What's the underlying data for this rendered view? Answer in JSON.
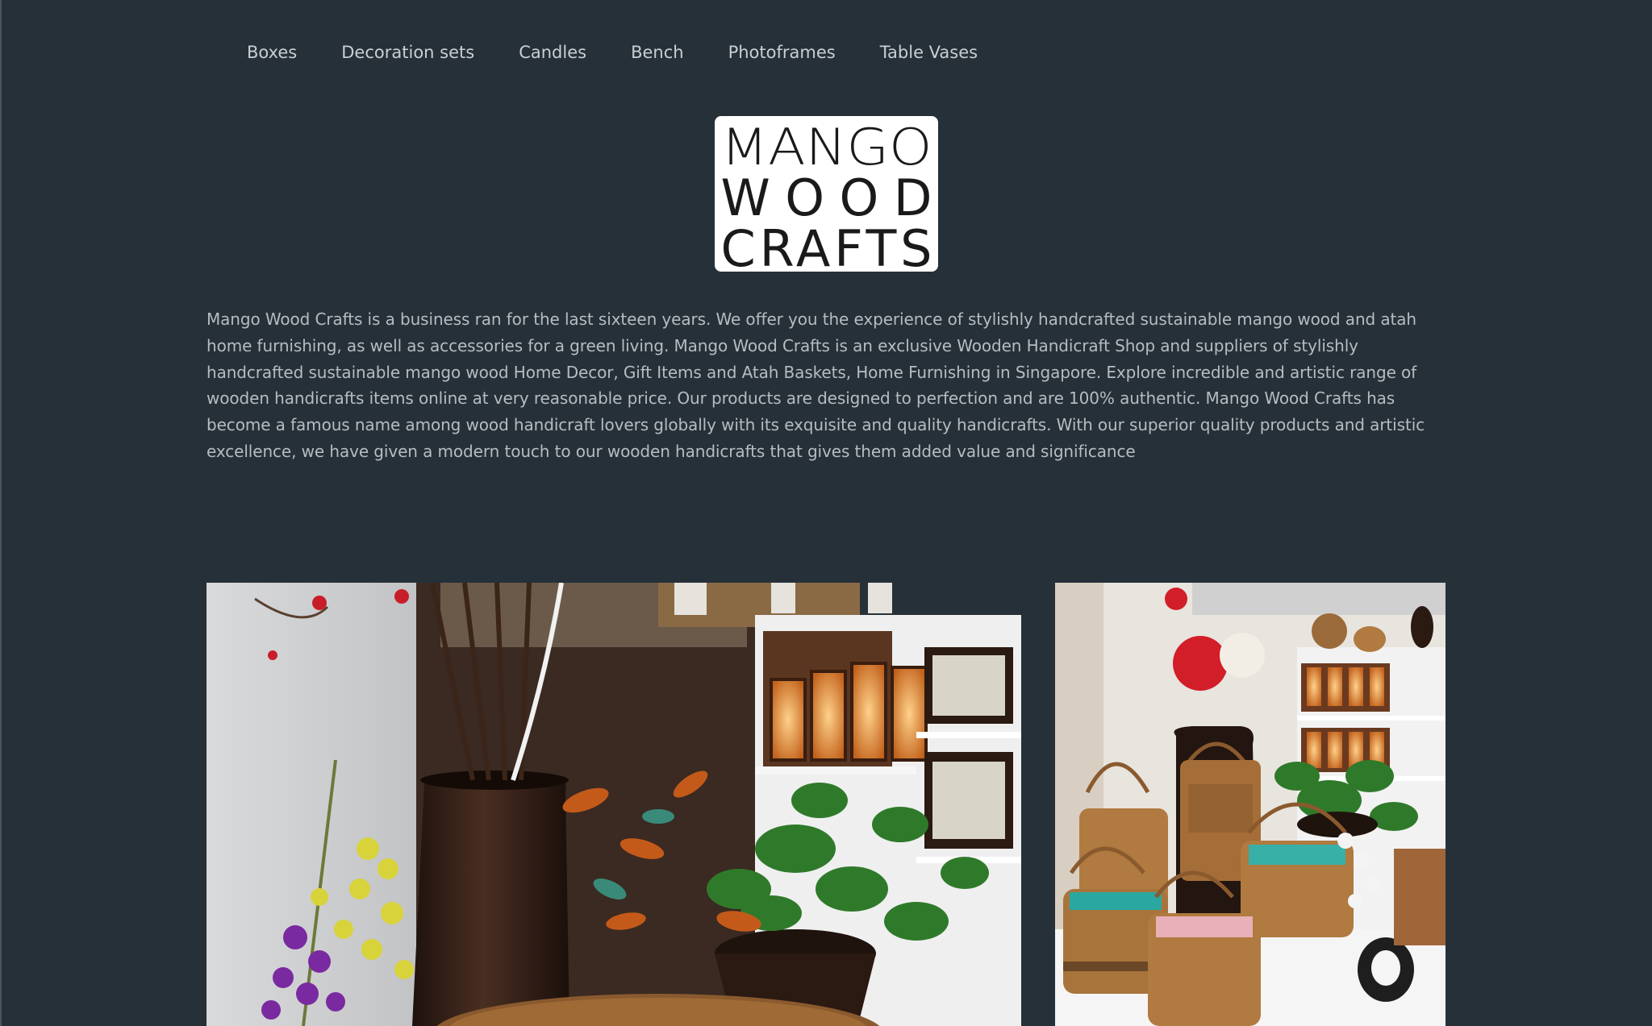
{
  "nav": {
    "items": [
      {
        "label": "Boxes"
      },
      {
        "label": "Decoration sets"
      },
      {
        "label": "Candles"
      },
      {
        "label": "Bench"
      },
      {
        "label": "Photoframes"
      },
      {
        "label": "Table Vases"
      }
    ]
  },
  "logo": {
    "line1": "MANGO",
    "line2": "WOOD",
    "line3": "CRAFTS"
  },
  "description": "Mango Wood Crafts is a business ran for the last sixteen years. We offer you the experience of stylishly handcrafted sustainable mango wood and atah home furnishing, as well as accessories for a green living. Mango Wood Crafts is an exclusive Wooden Handicraft Shop and suppliers of stylishly handcrafted sustainable mango wood Home Decor, Gift Items and Atah Baskets, Home Furnishing in Singapore. Explore incredible and artistic range of wooden handicrafts items online at very reasonable price. Our products are designed to perfection and are 100% authentic. Mango Wood Crafts has become a famous name among wood handicraft lovers globally with its exquisite and quality handicrafts. With our superior quality products and artistic excellence, we have given a modern touch to our wooden handicrafts that gives them added value and significance",
  "colors": {
    "background": "#263038",
    "nav_text": "#c9ced3",
    "body_text": "#b6bcc2",
    "logo_bg": "#ffffff"
  }
}
